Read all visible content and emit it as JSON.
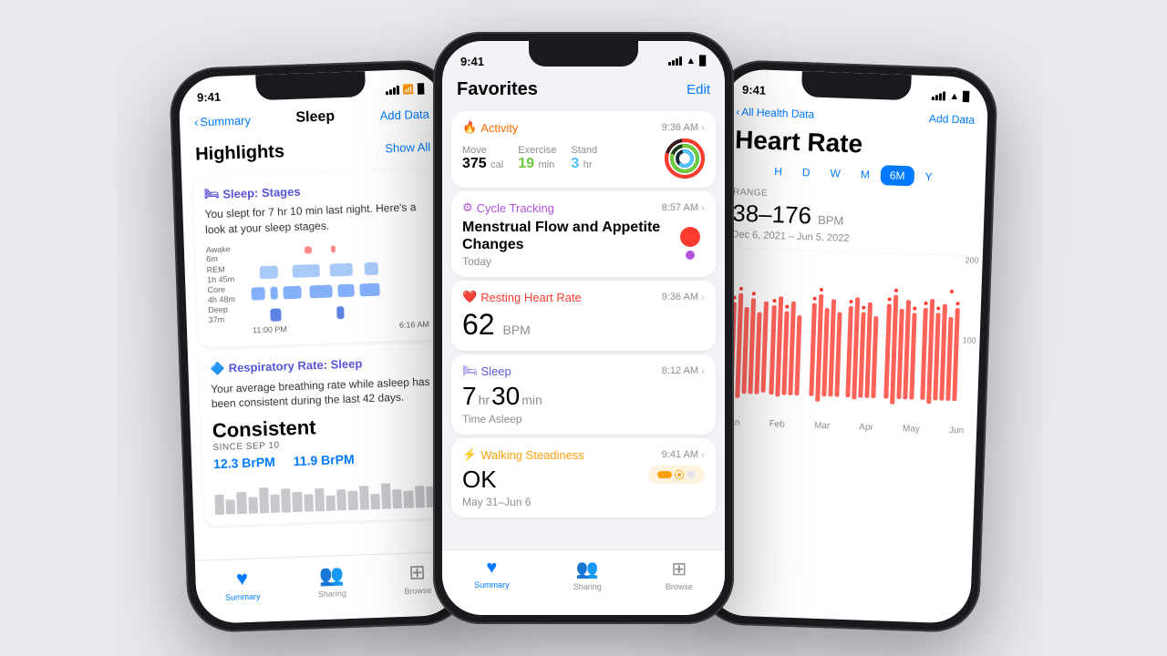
{
  "background": "#e8e8ed",
  "phones": {
    "left": {
      "status": {
        "time": "9:41",
        "signal": [
          3,
          5,
          7,
          9,
          11
        ],
        "wifi": true,
        "battery": true
      },
      "nav": {
        "back_label": "Summary",
        "title": "Sleep",
        "add_label": "Add Data"
      },
      "highlights": {
        "title": "Highlights",
        "show_all": "Show All"
      },
      "sleep_stages": {
        "title": "Sleep: Stages",
        "description": "You slept for 7 hr 10 min last night. Here's a look at your sleep stages.",
        "labels": [
          "Awake\n6m",
          "REM\n1h 45m",
          "Core\n4h 48m",
          "Deep\n37m"
        ],
        "time_start": "11:00 PM",
        "time_end": "6:16 AM"
      },
      "respiratory": {
        "title": "Respiratory Rate: Sleep",
        "description": "Your average breathing rate while asleep has been consistent during the last 42 days.",
        "consistent_label": "Consistent",
        "since_label": "SINCE SEP 10",
        "value1": "12.3 BrPM",
        "value2": "11.9 BrPM"
      },
      "tabs": [
        {
          "icon": "❤️",
          "label": "Summary",
          "active": true
        },
        {
          "icon": "👥",
          "label": "Sharing",
          "active": false
        },
        {
          "icon": "⊞",
          "label": "Browse",
          "active": false
        }
      ]
    },
    "center": {
      "status": {
        "time": "9:41",
        "signal": true,
        "wifi": true,
        "battery": true
      },
      "nav": {
        "title": "Favorites",
        "edit_label": "Edit"
      },
      "cards": [
        {
          "id": "activity",
          "icon": "🔥",
          "title": "Activity",
          "time": "9:36 AM",
          "move_label": "Move",
          "move_value": "375",
          "move_unit": "cal",
          "exercise_label": "Exercise",
          "exercise_value": "19",
          "exercise_unit": "min",
          "stand_label": "Stand",
          "stand_value": "3",
          "stand_unit": "hr"
        },
        {
          "id": "cycle",
          "icon": "⚙",
          "title": "Cycle Tracking",
          "time": "8:57 AM",
          "main_text": "Menstrual Flow and Appetite Changes",
          "sub_text": "Today"
        },
        {
          "id": "heart",
          "icon": "❤️",
          "title": "Resting Heart Rate",
          "time": "9:36 AM",
          "value": "62",
          "unit": "BPM"
        },
        {
          "id": "sleep",
          "icon": "🛏",
          "title": "Sleep",
          "time": "8:12 AM",
          "hours": "7",
          "minutes": "30",
          "sub_text": "Time Asleep"
        },
        {
          "id": "walking",
          "icon": "⚡",
          "title": "Walking Steadiness",
          "time": "9:41 AM",
          "value": "OK",
          "sub_text": "May 31–Jun 6"
        }
      ],
      "tabs": [
        {
          "label": "Summary",
          "active": true
        },
        {
          "label": "Sharing",
          "active": false
        },
        {
          "label": "Browse",
          "active": false
        }
      ]
    },
    "right": {
      "status": {
        "time": "9:41",
        "signal": true,
        "wifi": true,
        "battery": true
      },
      "nav": {
        "back_label": "All Health Data",
        "title": "Heart Rate",
        "add_label": "Add Data"
      },
      "time_filters": [
        "H",
        "D",
        "W",
        "M",
        "6M",
        "Y"
      ],
      "active_filter": "6M",
      "range_label": "RANGE",
      "range_value": "38–176",
      "range_unit": "BPM",
      "date_range": "Dec 6, 2021 – Jun 5, 2022",
      "y_labels": [
        "200",
        "100"
      ],
      "month_labels": [
        "Jan",
        "Feb",
        "Mar",
        "Apr",
        "May",
        "Jun"
      ]
    }
  }
}
